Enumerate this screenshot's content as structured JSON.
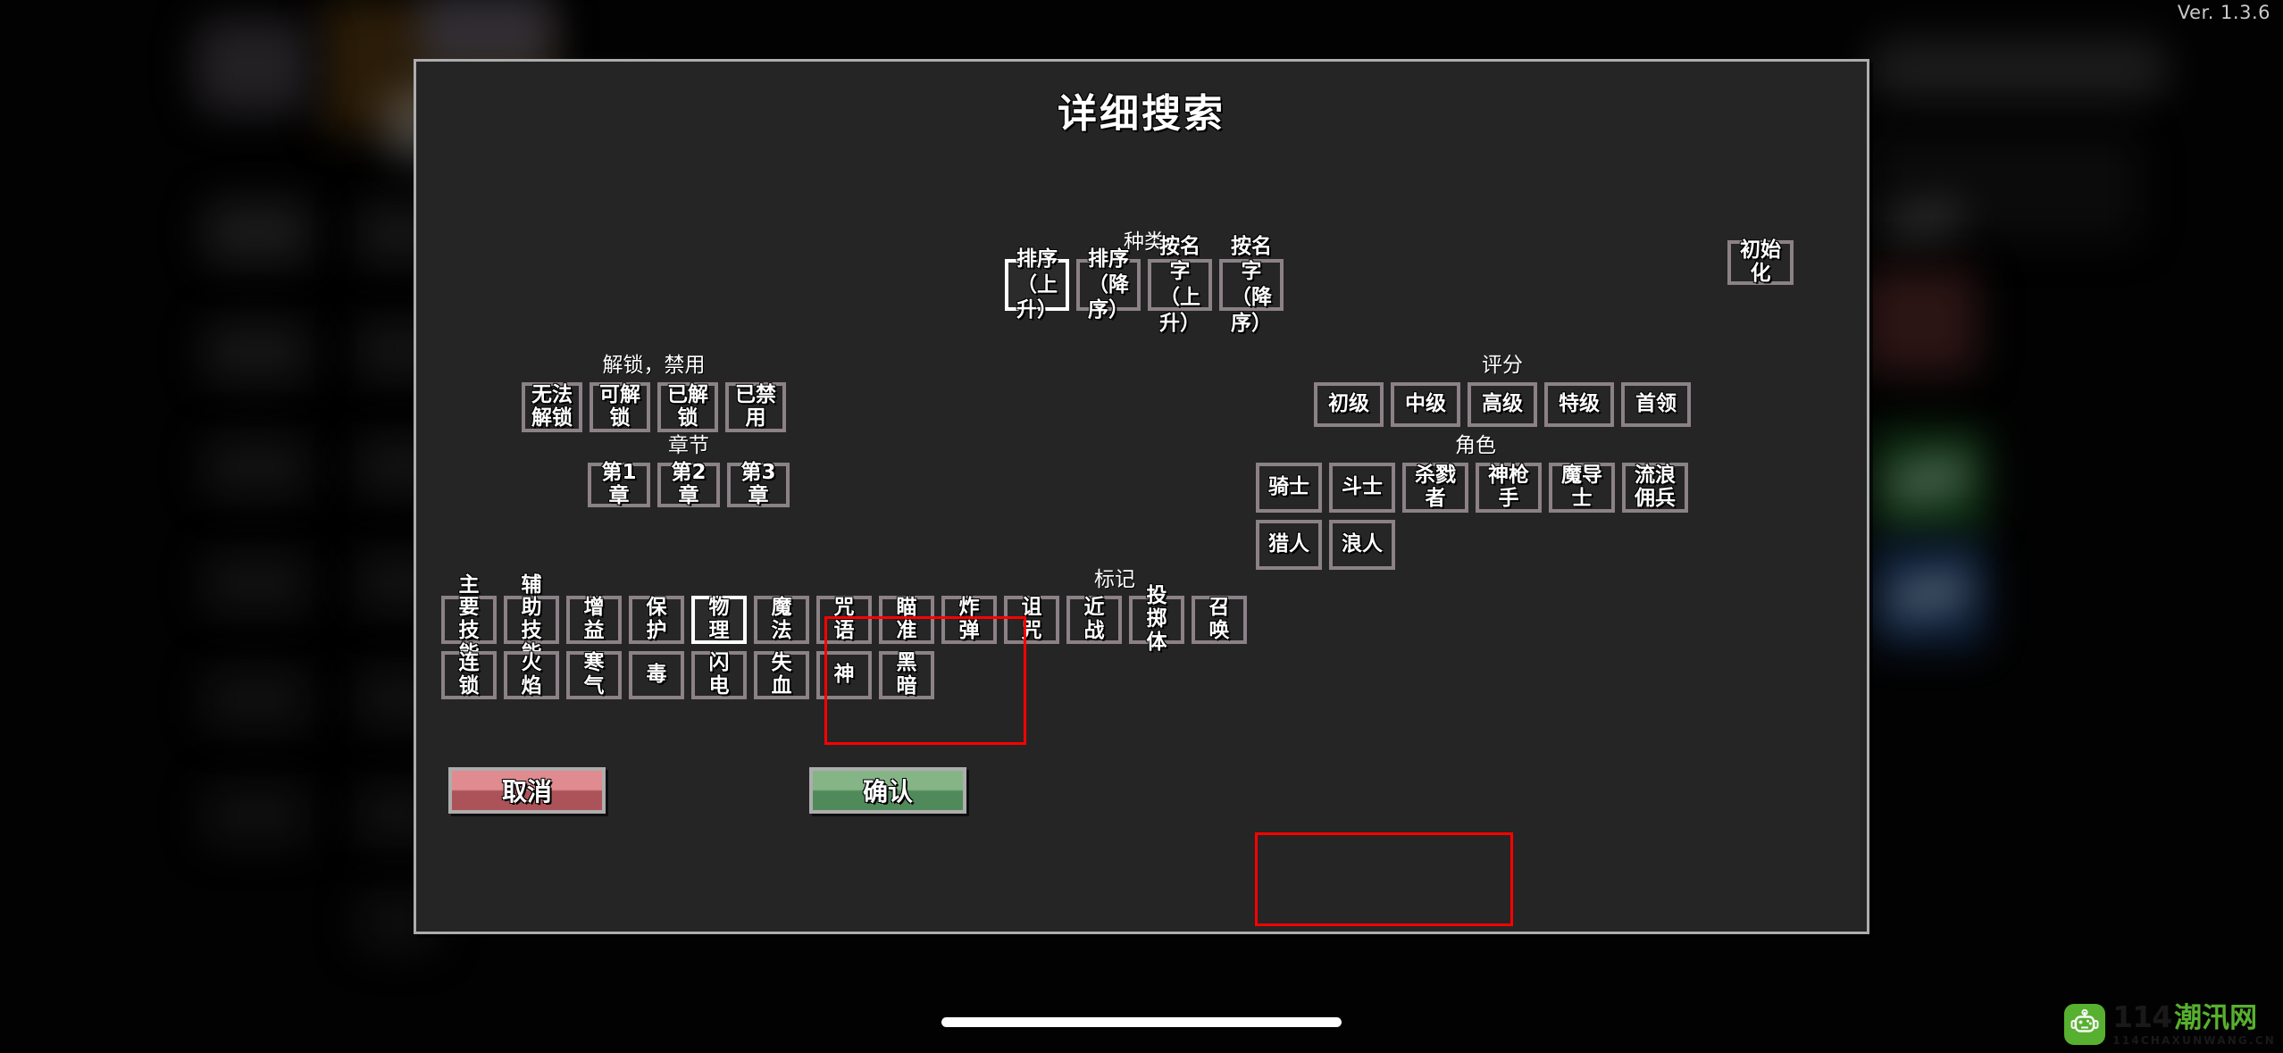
{
  "app": {
    "version_label": "Ver. 1.3.6"
  },
  "dialog": {
    "title": "详细搜索",
    "reset_button": "初始化"
  },
  "sections": {
    "kind": {
      "label": "种类",
      "options": [
        {
          "line1": "排序",
          "line2": "（上升）",
          "selected": true
        },
        {
          "line1": "排序",
          "line2": "（降序）",
          "selected": false
        },
        {
          "line1": "按名字",
          "line2": "（上升）",
          "selected": false
        },
        {
          "line1": "按名字",
          "line2": "（降序）",
          "selected": false
        }
      ]
    },
    "lock": {
      "label": "解锁，禁用",
      "options": [
        {
          "text": "无法解锁",
          "selected": false
        },
        {
          "text": "可解锁",
          "selected": false
        },
        {
          "text": "已解锁",
          "selected": false
        },
        {
          "text": "已禁用",
          "selected": false
        }
      ]
    },
    "rating": {
      "label": "评分",
      "options": [
        {
          "text": "初级",
          "selected": false
        },
        {
          "text": "中级",
          "selected": false
        },
        {
          "text": "高级",
          "selected": false
        },
        {
          "text": "特级",
          "selected": false
        },
        {
          "text": "首领",
          "selected": false
        }
      ]
    },
    "chapter": {
      "label": "章节",
      "options": [
        {
          "text": "第1章",
          "selected": false
        },
        {
          "text": "第2章",
          "selected": false
        },
        {
          "text": "第3章",
          "selected": false
        }
      ]
    },
    "role": {
      "label": "角色",
      "row1": [
        {
          "text": "骑士",
          "selected": false
        },
        {
          "text": "斗士",
          "selected": false
        },
        {
          "text": "杀戮者",
          "selected": false
        },
        {
          "text": "神枪手",
          "selected": false
        },
        {
          "text": "魔导士",
          "selected": false
        },
        {
          "text": "流浪佣兵",
          "selected": false
        }
      ],
      "row2": [
        {
          "text": "猎人",
          "selected": false
        },
        {
          "text": "浪人",
          "selected": false
        }
      ]
    },
    "tag": {
      "label": "标记",
      "row1": [
        {
          "text": "主要技能",
          "selected": false
        },
        {
          "text": "辅助技能",
          "selected": false
        },
        {
          "text": "增益",
          "selected": false
        },
        {
          "text": "保护",
          "selected": false
        },
        {
          "text": "物理",
          "selected": true
        },
        {
          "text": "魔法",
          "selected": false
        },
        {
          "text": "咒语",
          "selected": false
        },
        {
          "text": "瞄准",
          "selected": false
        },
        {
          "text": "炸弹",
          "selected": false
        },
        {
          "text": "诅咒",
          "selected": false
        },
        {
          "text": "近战",
          "selected": false
        },
        {
          "text": "投掷体",
          "selected": false
        },
        {
          "text": "召唤",
          "selected": false
        }
      ],
      "row2": [
        {
          "text": "连锁",
          "selected": false
        },
        {
          "text": "火焰",
          "selected": false
        },
        {
          "text": "寒气",
          "selected": false
        },
        {
          "text": "毒",
          "selected": false
        },
        {
          "text": "闪电",
          "selected": false
        },
        {
          "text": "失血",
          "selected": false
        },
        {
          "text": "神",
          "selected": false
        },
        {
          "text": "黑暗",
          "selected": false
        }
      ]
    }
  },
  "footer": {
    "cancel_label": "取消",
    "confirm_label": "确认"
  },
  "annotations": {
    "highlight_color": "#fe0000",
    "items": [
      "物理",
      "确认"
    ]
  },
  "watermark": {
    "name": "114",
    "name_cn": "潮汛网",
    "domain": "114CHAXUNWANG.CN",
    "brand_color": "#5ab631"
  }
}
